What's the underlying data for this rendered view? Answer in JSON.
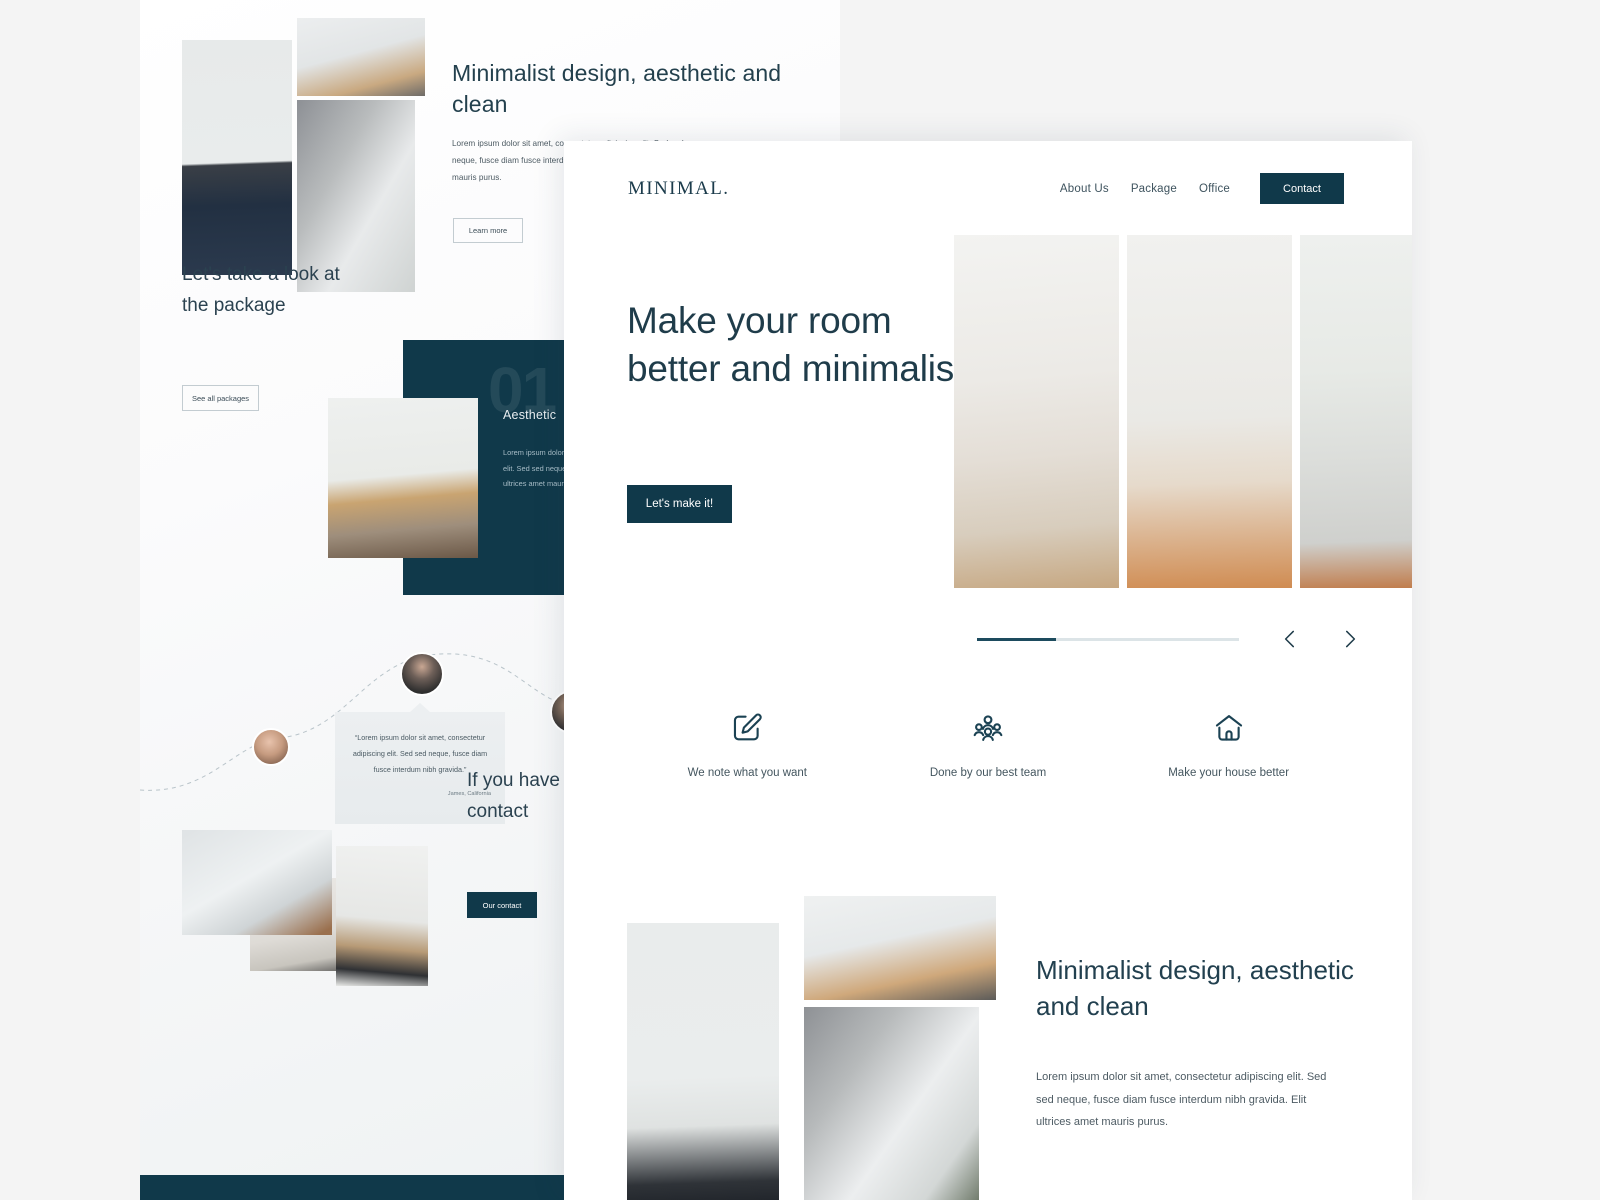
{
  "back_page": {
    "hero": {
      "title": "Minimalist design, aesthetic and clean",
      "paragraph": "Lorem ipsum dolor sit amet, consectetur adipiscing elit. Sed sed neque, fusce diam fusce interdum nibh gravida. Elit ultrices amet mauris purus.",
      "button": "Learn more"
    },
    "package": {
      "title": "Let's take a look at the package",
      "button": "See all packages",
      "card_number": "01",
      "card_title": "Aesthetic",
      "card_body": "Lorem ipsum dolor sit amet, consectetur adipiscing elit. Sed sed neque, fusce interdum nibh gravida. Elit ultrices amet mauris purus."
    },
    "testimonial": {
      "quote": "“Lorem ipsum dolor sit amet, consectetur adipiscing elit. Sed sed neque, fusce diam fusce interdum nibh gravida.”",
      "author": "James, California"
    },
    "contact": {
      "title": "If you have questions free to contact",
      "button": "Our contact"
    }
  },
  "front_page": {
    "nav": {
      "logo": "MINIMAL.",
      "links": [
        {
          "label": "About Us"
        },
        {
          "label": "Package"
        },
        {
          "label": "Office"
        }
      ],
      "cta": "Contact"
    },
    "hero": {
      "title": "Make your room better and minimalist",
      "button": "Let's make it!"
    },
    "carousel": {
      "progress_percent": 30,
      "prev_label": "Previous slide",
      "next_label": "Next slide"
    },
    "features": [
      {
        "icon": "edit-square-icon",
        "label": "We note what you want"
      },
      {
        "icon": "team-group-icon",
        "label": "Done by our best team"
      },
      {
        "icon": "house-icon",
        "label": "Make your house better"
      }
    ],
    "bottom": {
      "title": "Minimalist design, aesthetic and clean",
      "paragraph": "Lorem ipsum dolor sit amet, consectetur adipiscing elit. Sed sed neque, fusce diam fusce interdum nibh gravida. Elit ultrices amet mauris purus."
    }
  },
  "colors": {
    "brand_dark": "#10394a",
    "heading": "#22404f",
    "body_text": "#4d5b63",
    "canvas": "#f4f4f4"
  }
}
